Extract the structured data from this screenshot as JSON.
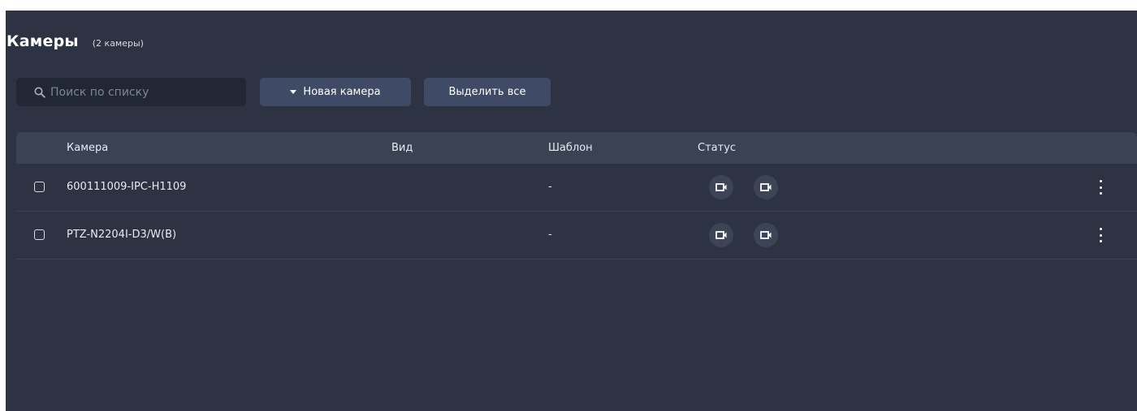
{
  "page": {
    "title": "Камеры",
    "count_label": "(2 камеры)"
  },
  "toolbar": {
    "search_placeholder": "Поиск по списку",
    "search_value": "",
    "new_camera_label": "Новая камера",
    "select_all_label": "Выделить все"
  },
  "table": {
    "columns": {
      "camera": "Камера",
      "view": "Вид",
      "template": "Шаблон",
      "status": "Статус"
    },
    "rows": [
      {
        "name": "600111009-IPC-H1109",
        "view": "",
        "template": "-",
        "status_icons": [
          "camera-icon",
          "camera-icon"
        ],
        "checked": false
      },
      {
        "name": "PTZ-N2204I-D3/W(B)",
        "view": "",
        "template": "-",
        "status_icons": [
          "camera-icon",
          "camera-icon"
        ],
        "checked": false
      }
    ]
  },
  "colors": {
    "background": "#2d3343",
    "table_header": "#3b4254",
    "button": "#3f4b66",
    "search_bg": "#222735"
  }
}
